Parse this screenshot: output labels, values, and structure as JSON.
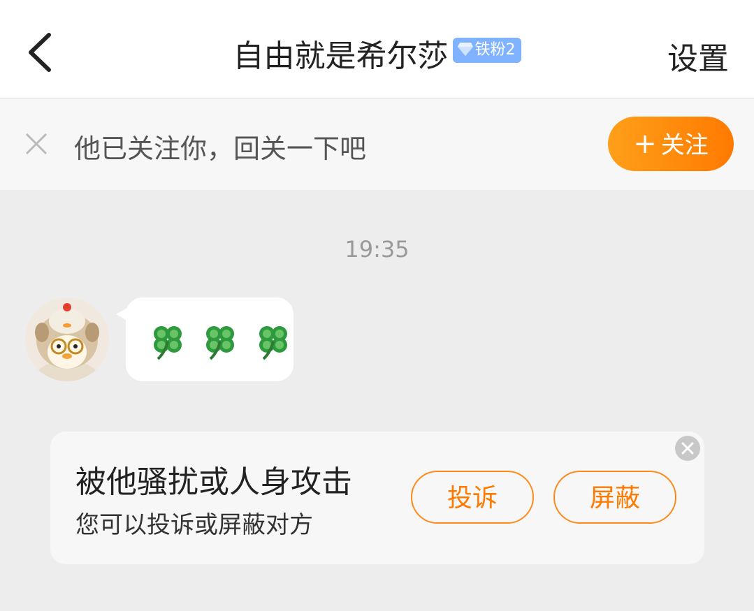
{
  "header": {
    "title": "自由就是希尔莎",
    "fan_badge": {
      "label": "铁粉2",
      "icon": "diamond-icon",
      "color": "#7fb2ff"
    },
    "settings_label": "设置",
    "back_icon": "chevron-left-icon"
  },
  "follow_prompt": {
    "text": "他已关注你，回关一下吧",
    "follow_button_label": "关注",
    "follow_button_icon": "plus-icon",
    "close_icon": "close-icon",
    "accent_color": "#ff8a1a"
  },
  "chat": {
    "timestamp": "19:35",
    "messages": [
      {
        "from": "other",
        "content": "🍀🍀🍀",
        "avatar": "duck-avatar"
      }
    ]
  },
  "safety_card": {
    "title": "被他骚扰或人身攻击",
    "subtitle": "您可以投诉或屏蔽对方",
    "complain_label": "投诉",
    "block_label": "屏蔽",
    "close_icon": "close-icon"
  }
}
